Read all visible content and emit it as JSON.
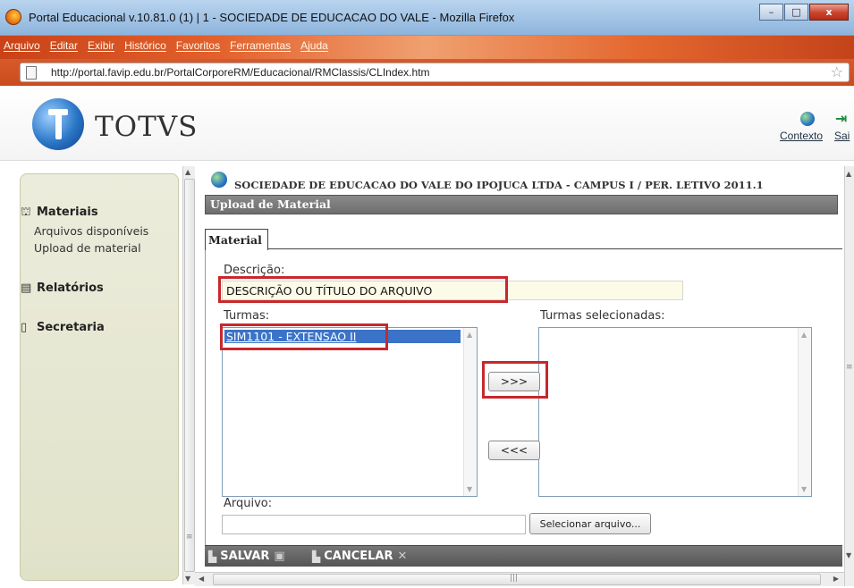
{
  "window": {
    "title": "Portal Educacional v.10.81.0 (1) | 1 - SOCIEDADE DE EDUCACAO DO VALE - Mozilla Firefox",
    "minimize": "–",
    "maximize": "□",
    "close": "x"
  },
  "menubar": [
    "Arquivo",
    "Editar",
    "Exibir",
    "Histórico",
    "Favoritos",
    "Ferramentas",
    "Ajuda"
  ],
  "address": {
    "url": "http://portal.favip.edu.br/PortalCorporeRM/Educacional/RMClassis/CLIndex.htm"
  },
  "header": {
    "logo_text": "TOTVS",
    "contexto_label": "Contexto",
    "sair_label": "Sai"
  },
  "sidebar": {
    "groups": [
      {
        "label": "Materiais",
        "icon": "briefcase-icon",
        "items": [
          "Arquivos disponíveis",
          "Upload de material"
        ]
      },
      {
        "label": "Relatórios",
        "icon": "report-icon",
        "items": []
      },
      {
        "label": "Secretaria",
        "icon": "clipboard-icon",
        "items": []
      }
    ]
  },
  "main": {
    "org_line": "SOCIEDADE DE EDUCACAO DO VALE DO IPOJUCA LTDA - CAMPUS I / PER. LETIVO 2011.1",
    "section_title": "Upload de Material",
    "tab_label": "Material",
    "descricao_label": "Descrição:",
    "descricao_value": "DESCRIÇÃO OU TÍTULO DO ARQUIVO",
    "turmas_label": "Turmas:",
    "turmas_items": [
      "SIM1101 - EXTENSAO II"
    ],
    "turmas_selecionadas_label": "Turmas selecionadas:",
    "add_button": ">>>",
    "remove_button": "<<<",
    "arquivo_label": "Arquivo:",
    "arquivo_value": "",
    "select_file_button": "Selecionar arquivo...",
    "save_label": "SALVAR",
    "cancel_label": "CANCELAR"
  },
  "colors": {
    "highlight_red": "#c8282c",
    "selection_blue": "#3a73c8",
    "menubar_orange": "#e2602c"
  }
}
